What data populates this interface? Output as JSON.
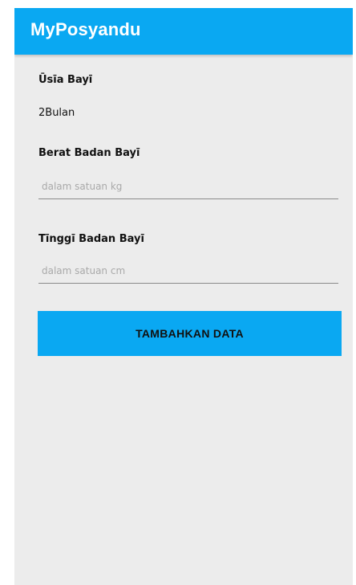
{
  "app_bar": {
    "title": "MyPosyandu",
    "color": "#0aa8f2"
  },
  "form": {
    "age": {
      "label": "Ūsīa Bayī",
      "value": "2Bulan"
    },
    "weight": {
      "label": "Berat Badan Bayī",
      "placeholder": "dalam satuan kg",
      "value": ""
    },
    "height": {
      "label": "Tīnggī Badan Bayī",
      "placeholder": "dalam satuan cm",
      "value": ""
    },
    "submit_label": "TAMBAHKAN DATA"
  },
  "colors": {
    "background": "#ececec",
    "accent": "#0aa8f2"
  }
}
